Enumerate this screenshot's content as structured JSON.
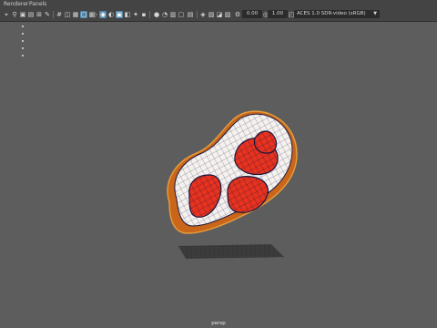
{
  "menubar": {
    "renderer": "Renderer",
    "panels": "Panels"
  },
  "toolbar": {
    "field_a": "0.00",
    "field_b": "1.00",
    "color_space": "ACES 1.0 SDR-video (sRGB)",
    "icons": [
      "select-camera-icon",
      "camera-attributes-icon",
      "bookmark-icon",
      "image-plane-icon",
      "2d-pan-zoom-icon",
      "grease-pencil-icon",
      "grid-icon",
      "film-gate-icon",
      "resolution-gate-icon",
      "gate-mask-icon",
      "field-chart-icon",
      "safe-action-icon",
      "wireframe-icon",
      "smooth-shade-icon",
      "default-material-icon",
      "textured-icon",
      "use-all-lights-icon",
      "shadows-icon",
      "screen-space-ao-icon",
      "motion-blur-icon",
      "anti-aliasing-icon",
      "depth-of-field-icon",
      "isolate-select-icon",
      "xray-icon",
      "xray-active-components-icon",
      "xray-joints-icon",
      "exposure-icon",
      "gamma-icon",
      "color-management-icon"
    ],
    "active_icons": [
      "film-gate-icon",
      "resolution-gate-icon",
      "textured-icon",
      "xray-icon"
    ]
  },
  "viewport": {
    "camera_label": "persp",
    "background_color": "#5d5d5d",
    "object": "steak-model"
  },
  "colors": {
    "crust": "#e07a1a",
    "fat": "#f4f1ee",
    "meat": "#e8321e",
    "wire": "#1a1740",
    "shadow": "#3a3a3a"
  }
}
